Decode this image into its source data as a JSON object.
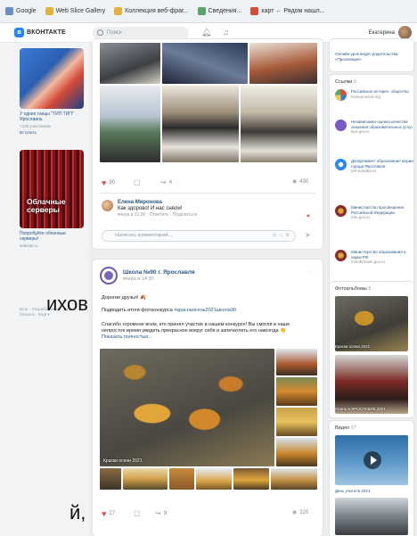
{
  "browser": {
    "bookmarks": [
      {
        "label": "Google"
      },
      {
        "label": "Web Slice Gallery"
      },
      {
        "label": "Коллекция веб-фраг..."
      },
      {
        "label": "Сведения..."
      },
      {
        "label": "карт ← Рядом нашл..."
      }
    ]
  },
  "header": {
    "logo_text": "ВКОНТАКТЕ",
    "search_placeholder": "Поиск",
    "user_name": "Екатерина"
  },
  "left_ads": [
    {
      "title": "У одних танцы \"ТИП ТИП\" Ярославль",
      "sub": "+100 участников",
      "link": "Вступить"
    },
    {
      "overlay": "Облачные серверы",
      "title": "Попробуйте облачные серверы!",
      "sub": "selectel.ru"
    }
  ],
  "left_overlay": {
    "line1": "ихов,",
    "line2": "й,"
  },
  "footer_links": "Блог · Разработчикам · Для бизнеса · Ещё ▾",
  "post1": {
    "likes": "90",
    "reposts": "4",
    "views": "430",
    "comment": {
      "name": "Елена Миронова",
      "text": "Как здорово! И нас сняли!",
      "meta": "вчера в 21:00 · Ответить · Поделиться"
    },
    "comment_placeholder": "Написать комментарий..."
  },
  "post2": {
    "author": "Школа №90 г. Ярославля",
    "date": "вчера в 14:30",
    "greeting": "Дорогие друзья! 🍂",
    "line1_prefix": "Подводить итоги фотоконкурса ",
    "hashtag": "#краснаясень2021школа90",
    "text": "Спасибо огромное всем, кто принял участие в нашем конкурсе! Вы смогли в наше непростое время увидеть прекрасное вокруг себя и запечатлеть его навсегда 👏",
    "more": "Показать полностью...",
    "photo_caption": "Краски осени 2021",
    "likes": "27",
    "reposts": "9",
    "views": "320"
  },
  "right_top_link": "Онлайн-урок видео родительства «Проспекция»",
  "links": {
    "title": "Ссылки",
    "count": "9",
    "items": [
      {
        "title": "Российское историч. общество",
        "sub": "historyrussia.org"
      },
      {
        "title": "Независимая оценка качества оказания образовательных услуг",
        "sub": "bus.gov.ru"
      },
      {
        "title": "Департамент образования мэрии города Ярославля",
        "sub": "yar-edudep.ru"
      },
      {
        "title": "Министерство просвещения Российской Федерации",
        "sub": "edu.gov.ru"
      },
      {
        "title": "Министерство образования и науки РФ",
        "sub": "minobrnauki.gov.ru"
      }
    ]
  },
  "albums": {
    "title": "Фотоальбомы",
    "count": "8",
    "caption1": "Краски осени 2021",
    "caption2": "Осень в ЯРОСЛАВЛЕ 2021"
  },
  "videos": {
    "title": "Видео",
    "count": "27",
    "caption": "День учителя 2021"
  },
  "colors": {
    "accent": "#2787f5",
    "link": "#2a5885",
    "like": "#e64646",
    "bg": "#edeef0"
  }
}
